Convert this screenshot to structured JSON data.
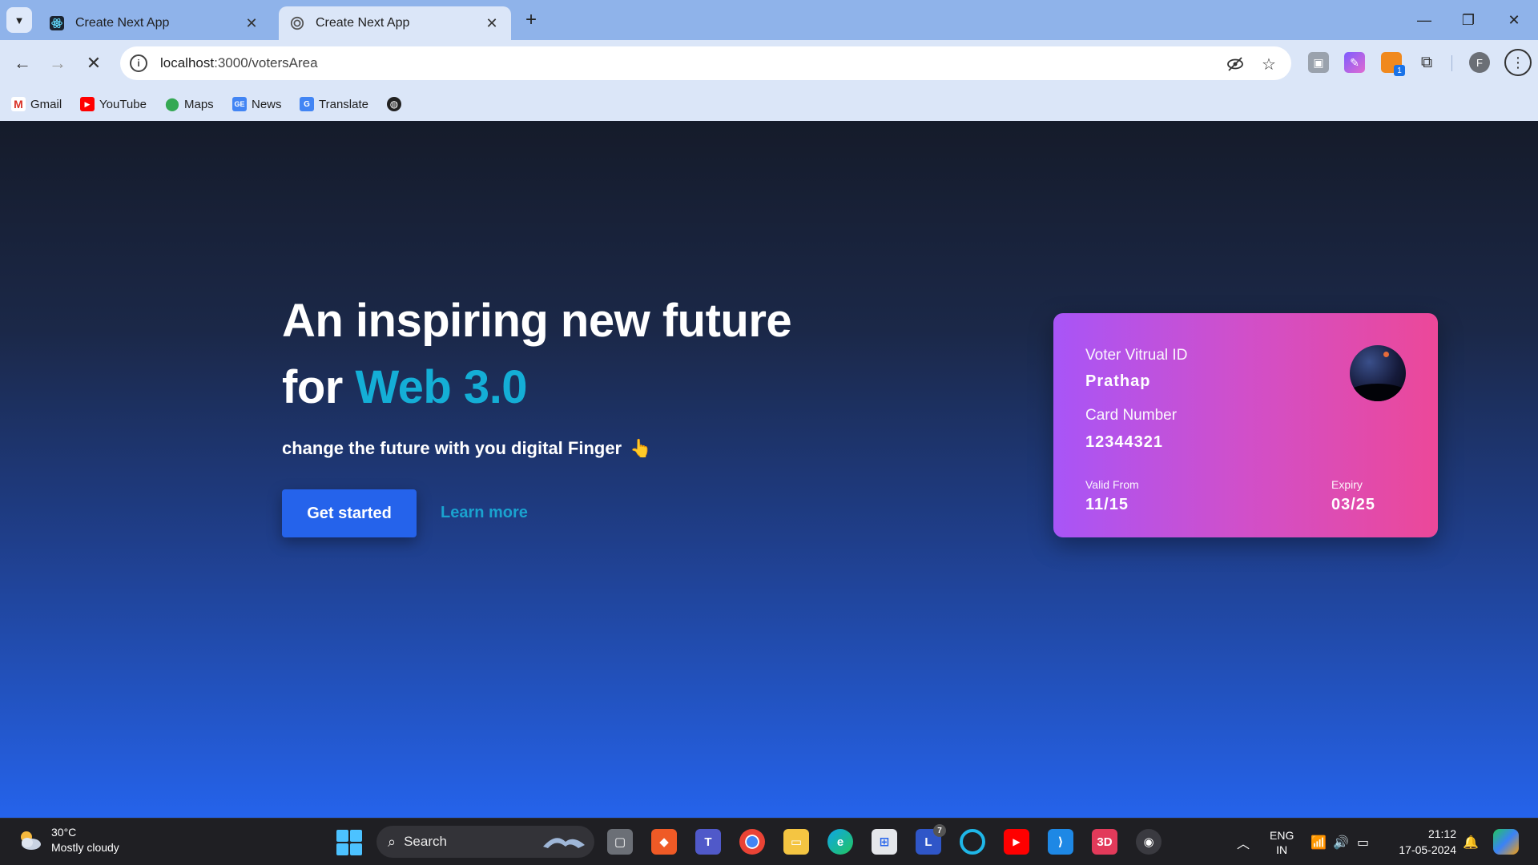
{
  "browser": {
    "tabs": [
      {
        "title": "Create Next App",
        "active": false
      },
      {
        "title": "Create Next App",
        "active": true
      }
    ],
    "address": {
      "host": "localhost",
      "path": ":3000/votersArea"
    },
    "bookmarks": [
      {
        "label": "Gmail",
        "icon": "gmail-icon"
      },
      {
        "label": "YouTube",
        "icon": "youtube-icon"
      },
      {
        "label": "Maps",
        "icon": "maps-icon"
      },
      {
        "label": "News",
        "icon": "news-icon"
      },
      {
        "label": "Translate",
        "icon": "translate-icon"
      }
    ],
    "profile_initial": "F",
    "extension_badge": "1"
  },
  "hero": {
    "title_line1": "An inspiring new future",
    "title_line2_prefix": "for ",
    "title_line2_accent": "Web 3.0",
    "subtitle": "change the future with you digital Finger",
    "primary_button": "Get started",
    "secondary_link": "Learn more"
  },
  "card": {
    "id_label": "Voter Vitrual ID",
    "name": "Prathap",
    "number_label": "Card Number",
    "number": "12344321",
    "valid_label": "Valid From",
    "valid": "11/15",
    "expiry_label": "Expiry",
    "expiry": "03/25"
  },
  "taskbar": {
    "weather_temp": "30°C",
    "weather_desc": "Mostly cloudy",
    "search_placeholder": "Search",
    "lang_line1": "ENG",
    "lang_line2": "IN",
    "time": "21:12",
    "date": "17-05-2024",
    "linkedin_badge": "7",
    "app_3d_label": "3D"
  },
  "colors": {
    "accent_cyan": "#14aed6",
    "primary_blue": "#2563eb",
    "card_start": "#a855f7",
    "card_end": "#ec4899"
  }
}
